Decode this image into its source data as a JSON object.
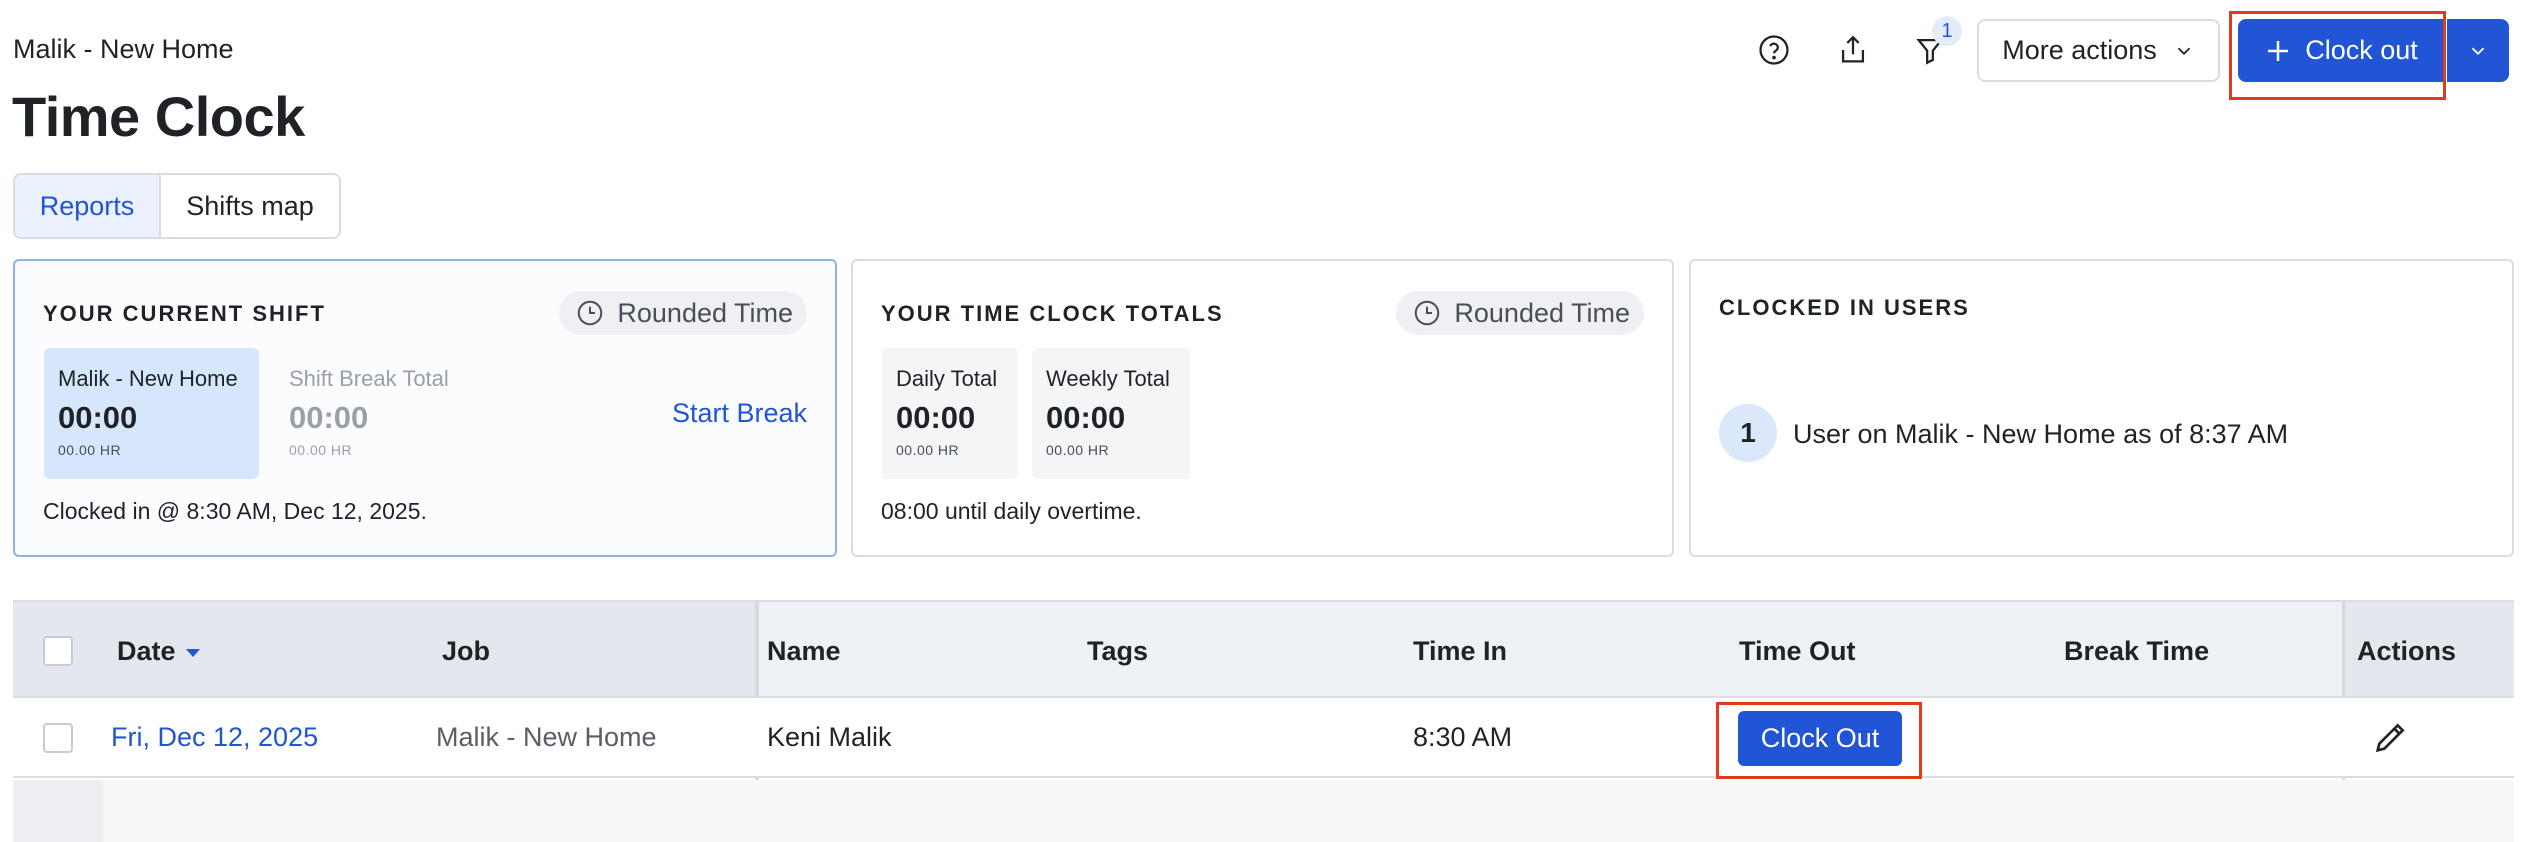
{
  "header": {
    "breadcrumb": "Malik - New Home",
    "title": "Time Clock",
    "icons": [
      "help-icon",
      "share-icon",
      "filter-icon"
    ],
    "filter_badge": "1",
    "more_actions": "More actions",
    "clock_out": "Clock out"
  },
  "tabs": [
    {
      "label": "Reports",
      "active": true
    },
    {
      "label": "Shifts map",
      "active": false
    }
  ],
  "current_shift": {
    "title": "YOUR CURRENT SHIFT",
    "rounded": "Rounded Time",
    "stats": [
      {
        "label": "Malik - New Home",
        "value": "00:00",
        "sub": "00.00 HR"
      },
      {
        "label": "Shift Break Total",
        "value": "00:00",
        "sub": "00.00 HR"
      }
    ],
    "start_break": "Start Break",
    "footer": "Clocked in @ 8:30 AM, Dec 12, 2025."
  },
  "totals": {
    "title": "YOUR TIME CLOCK TOTALS",
    "rounded": "Rounded Time",
    "stats": [
      {
        "label": "Daily Total",
        "value": "00:00",
        "sub": "00.00 HR"
      },
      {
        "label": "Weekly Total",
        "value": "00:00",
        "sub": "00.00 HR"
      }
    ],
    "footer": "08:00 until daily overtime."
  },
  "users": {
    "title": "CLOCKED IN USERS",
    "count": "1",
    "text": "User on Malik - New Home as of 8:37 AM"
  },
  "table": {
    "columns": [
      "Date",
      "Job",
      "Name",
      "Tags",
      "Time In",
      "Time Out",
      "Break Time",
      "Actions"
    ],
    "rows": [
      {
        "date": "Fri, Dec 12, 2025",
        "job": "Malik - New Home",
        "name": "Keni Malik",
        "tags": "",
        "time_in": "8:30 AM",
        "time_out_button": "Clock Out",
        "break_time": ""
      }
    ]
  },
  "colors": {
    "primary": "#2254d6",
    "highlight": "#e23a1c",
    "stat_highlight": "#d6e6fb"
  }
}
